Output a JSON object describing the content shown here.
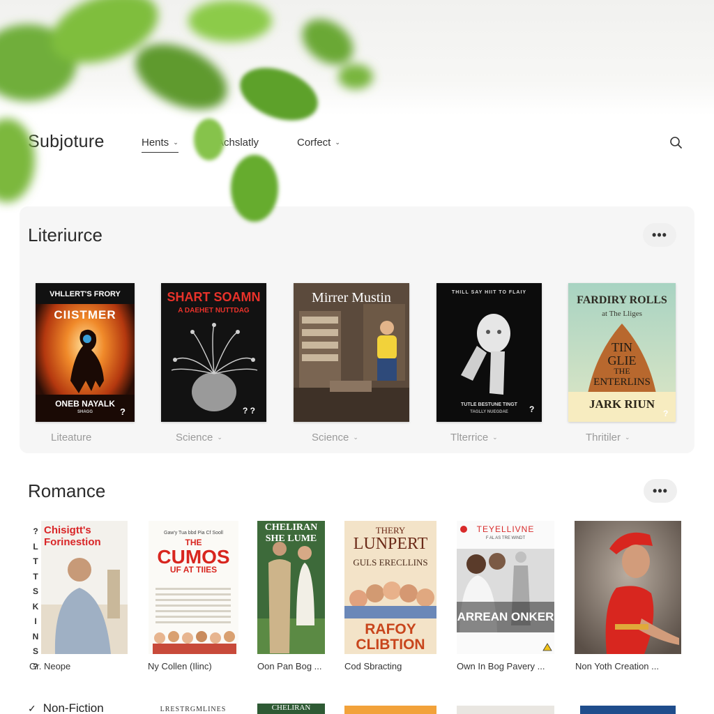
{
  "nav": {
    "brand": "Subjoture",
    "items": [
      {
        "label": "Hents",
        "has_menu": true,
        "active": true
      },
      {
        "label": "Achslatly",
        "has_menu": false,
        "active": false
      },
      {
        "label": "Corfect",
        "has_menu": true,
        "active": false
      }
    ]
  },
  "literature": {
    "title": "Literiurce",
    "more": "•••",
    "books": [
      {
        "line1": "VHLLERT'S FRORY",
        "line2": "CIISTMER",
        "line3": "ONEB NAYALK",
        "line4": "SHAGG",
        "mark": "?",
        "category": "Liteature"
      },
      {
        "line1": "SHART SOAMN",
        "line2": "A DAEHET NUTTDAG",
        "mark": "? ?",
        "category": "Science"
      },
      {
        "line1": "Mirrer Mustin",
        "category": "Science"
      },
      {
        "line1": "THILL SAY HIIT TO FLAIY",
        "line2": "TUTLE BESTUNE TINGT",
        "line3": "TAGLLY NUEGDAE",
        "mark": "?",
        "category": "Tlterrice"
      },
      {
        "line1": "FARDIRY ROLLS",
        "line2": "at The Lliges",
        "line3": "TIN",
        "line4": "GLIE",
        "line5": "THE",
        "line6": "ENTERLINS",
        "line7": "JARK RIUN",
        "mark": "?",
        "category": "Thritiler"
      }
    ]
  },
  "romance": {
    "title": "Romance",
    "more": "•••",
    "side_letters": [
      "?",
      "L",
      "T",
      "T",
      "S",
      "K",
      "I",
      "N",
      "S",
      "?"
    ],
    "books": [
      {
        "line1": "Chisigtt's",
        "line2": "Forinestion",
        "caption": "Gr. Neope"
      },
      {
        "line1": "Gaw'y Tua bbd Pia Cf Sooll",
        "line2": "THE",
        "line3": "CUMOS",
        "line4": "UF AT TIIES",
        "caption": "Ny Collen (Ilinc)"
      },
      {
        "line1": "CHELIRAN",
        "line2": "SHE LUME",
        "caption": "Oon Pan Bog ..."
      },
      {
        "line1": "THERY",
        "line2": "LUNPERT",
        "line3": "GULS ERECLLINS",
        "line4": "RAFOY",
        "line5": "CLIBTION",
        "caption": "Cod Sbracting"
      },
      {
        "line1": "TEYELLIVNE",
        "line2": "F AL AS TRE WINDT",
        "line3": "ARREAN ONKER",
        "caption": "Own In Bog Pavery ..."
      },
      {
        "caption": "Non Yoth Creation ..."
      }
    ]
  },
  "nonfiction": {
    "title": "Non-Fiction",
    "peek_labels": [
      "LRESTRGMLINES",
      "CHELIRAN"
    ]
  }
}
